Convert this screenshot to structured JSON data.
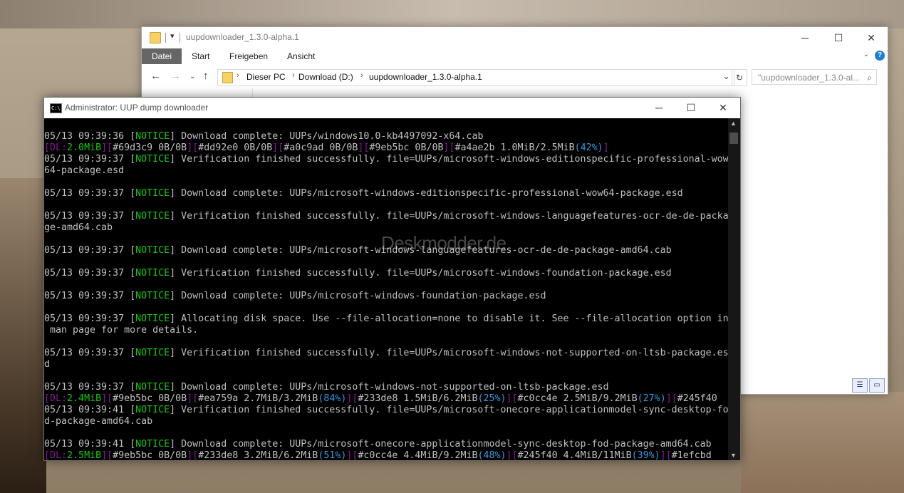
{
  "explorer": {
    "title": "uupdownloader_1.3.0-alpha.1",
    "window_buttons": {
      "minimize": "─",
      "maximize": "☐",
      "close": "✕"
    },
    "ribbon_tabs": [
      "Datei",
      "Start",
      "Freigeben",
      "Ansicht"
    ],
    "address": {
      "crumbs": [
        "Dieser PC",
        "Download (D:)",
        "uupdownloader_1.3.0-alpha.1"
      ],
      "search_placeholder": "\"uupdownloader_1.3.0-al..."
    }
  },
  "console": {
    "title": "Administrator:  UUP dump downloader",
    "window_buttons": {
      "minimize": "─",
      "maximize": "☐",
      "close": "✕"
    },
    "lines": [
      [
        {
          "t": "05/13 09:39:36 "
        },
        {
          "t": "[",
          "c": "g0"
        },
        {
          "t": "NOTICE",
          "c": "g"
        },
        {
          "t": "] Download complete: UUPs/windows10.0-kb4497092-x64.cab"
        }
      ],
      [
        {
          "t": "[",
          "c": "p"
        },
        {
          "t": "DL:",
          "c": "p"
        },
        {
          "t": "2.0MiB",
          "c": "g"
        },
        {
          "t": "][",
          "c": "p"
        },
        {
          "t": "#69d3c9 0B/0B"
        },
        {
          "t": "][",
          "c": "p"
        },
        {
          "t": "#dd92e0 0B/0B"
        },
        {
          "t": "][",
          "c": "p"
        },
        {
          "t": "#a0c9ad 0B/0B"
        },
        {
          "t": "][",
          "c": "p"
        },
        {
          "t": "#9eb5bc 0B/0B"
        },
        {
          "t": "][",
          "c": "p"
        },
        {
          "t": "#a4ae2b 1.0MiB/2.5MiB"
        },
        {
          "t": "(42%)",
          "c": "c"
        },
        {
          "t": "]",
          "c": "p"
        }
      ],
      [
        {
          "t": "05/13 09:39:37 [",
          "c": ""
        },
        {
          "t": "NOTICE",
          "c": "g"
        },
        {
          "t": "] Verification finished successfully. file=UUPs/microsoft-windows-editionspecific-professional-wow"
        }
      ],
      [
        {
          "t": "64-package.esd"
        }
      ],
      [
        {
          "t": ""
        }
      ],
      [
        {
          "t": "05/13 09:39:37 ["
        },
        {
          "t": "NOTICE",
          "c": "g"
        },
        {
          "t": "] Download complete: UUPs/microsoft-windows-editionspecific-professional-wow64-package.esd"
        }
      ],
      [
        {
          "t": ""
        }
      ],
      [
        {
          "t": "05/13 09:39:37 ["
        },
        {
          "t": "NOTICE",
          "c": "g"
        },
        {
          "t": "] Verification finished successfully. file=UUPs/microsoft-windows-languagefeatures-ocr-de-de-packa"
        }
      ],
      [
        {
          "t": "ge-amd64.cab"
        }
      ],
      [
        {
          "t": ""
        }
      ],
      [
        {
          "t": "05/13 09:39:37 ["
        },
        {
          "t": "NOTICE",
          "c": "g"
        },
        {
          "t": "] Download complete: UUPs/microsoft-windows-languagefeatures-ocr-de-de-package-amd64.cab"
        }
      ],
      [
        {
          "t": ""
        }
      ],
      [
        {
          "t": "05/13 09:39:37 ["
        },
        {
          "t": "NOTICE",
          "c": "g"
        },
        {
          "t": "] Verification finished successfully. file=UUPs/microsoft-windows-foundation-package.esd"
        }
      ],
      [
        {
          "t": ""
        }
      ],
      [
        {
          "t": "05/13 09:39:37 ["
        },
        {
          "t": "NOTICE",
          "c": "g"
        },
        {
          "t": "] Download complete: UUPs/microsoft-windows-foundation-package.esd"
        }
      ],
      [
        {
          "t": ""
        }
      ],
      [
        {
          "t": "05/13 09:39:37 ["
        },
        {
          "t": "NOTICE",
          "c": "g"
        },
        {
          "t": "] Allocating disk space. Use --file-allocation=none to disable it. See --file-allocation option in"
        }
      ],
      [
        {
          "t": " man page for more details."
        }
      ],
      [
        {
          "t": ""
        }
      ],
      [
        {
          "t": "05/13 09:39:37 ["
        },
        {
          "t": "NOTICE",
          "c": "g"
        },
        {
          "t": "] Verification finished successfully. file=UUPs/microsoft-windows-not-supported-on-ltsb-package.es"
        }
      ],
      [
        {
          "t": "d"
        }
      ],
      [
        {
          "t": ""
        }
      ],
      [
        {
          "t": "05/13 09:39:37 ["
        },
        {
          "t": "NOTICE",
          "c": "g"
        },
        {
          "t": "] Download complete: UUPs/microsoft-windows-not-supported-on-ltsb-package.esd"
        }
      ],
      [
        {
          "t": "[",
          "c": "p"
        },
        {
          "t": "DL:",
          "c": "p"
        },
        {
          "t": "2.4MiB",
          "c": "g"
        },
        {
          "t": "][",
          "c": "p"
        },
        {
          "t": "#9eb5bc 0B/0B"
        },
        {
          "t": "][",
          "c": "p"
        },
        {
          "t": "#ea759a 2.7MiB/3.2MiB"
        },
        {
          "t": "(84%)",
          "c": "c"
        },
        {
          "t": "][",
          "c": "p"
        },
        {
          "t": "#233de8 1.5MiB/6.2MiB"
        },
        {
          "t": "(25%)",
          "c": "c"
        },
        {
          "t": "][",
          "c": "p"
        },
        {
          "t": "#c0cc4e 2.5MiB/9.2MiB"
        },
        {
          "t": "(27%)",
          "c": "c"
        },
        {
          "t": "][",
          "c": "p"
        },
        {
          "t": "#245f40"
        }
      ],
      [
        {
          "t": "05/13 09:39:41 ["
        },
        {
          "t": "NOTICE",
          "c": "g"
        },
        {
          "t": "] Verification finished successfully. file=UUPs/microsoft-onecore-applicationmodel-sync-desktop-fo"
        }
      ],
      [
        {
          "t": "d-package-amd64.cab"
        }
      ],
      [
        {
          "t": ""
        }
      ],
      [
        {
          "t": "05/13 09:39:41 ["
        },
        {
          "t": "NOTICE",
          "c": "g"
        },
        {
          "t": "] Download complete: UUPs/microsoft-onecore-applicationmodel-sync-desktop-fod-package-amd64.cab"
        }
      ],
      [
        {
          "t": "[",
          "c": "p"
        },
        {
          "t": "DL:",
          "c": "p"
        },
        {
          "t": "2.5MiB",
          "c": "g"
        },
        {
          "t": "][",
          "c": "p"
        },
        {
          "t": "#9eb5bc 0B/0B"
        },
        {
          "t": "][",
          "c": "p"
        },
        {
          "t": "#233de8 3.2MiB/6.2MiB"
        },
        {
          "t": "(51%)",
          "c": "c"
        },
        {
          "t": "][",
          "c": "p"
        },
        {
          "t": "#c0cc4e 4.4MiB/9.2MiB"
        },
        {
          "t": "(48%)",
          "c": "c"
        },
        {
          "t": "][",
          "c": "p"
        },
        {
          "t": "#245f40 4.4MiB/11MiB"
        },
        {
          "t": "(39%)",
          "c": "c"
        },
        {
          "t": "][",
          "c": "p"
        },
        {
          "t": "#1efcbd"
        }
      ]
    ]
  },
  "watermark": "Deskmodder.de",
  "colors": {
    "notice": "#16c60c",
    "bracket": "#881798",
    "percent": "#3a96dd",
    "text": "#c0c0c0"
  },
  "icons": {
    "cmd": "C:\\",
    "folder": "folder-icon",
    "search": "⚲"
  }
}
